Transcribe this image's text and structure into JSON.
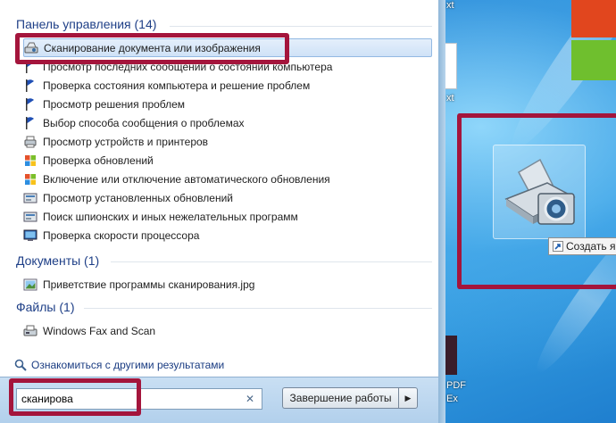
{
  "colors": {
    "annotation_red": "#a4153c",
    "group_header_blue": "#1e3f87",
    "selection_blue": "#cfe2f7",
    "desktop_blue": "#2b93dc"
  },
  "start_menu": {
    "groups": [
      {
        "header": "Панель управления (14)",
        "items": [
          {
            "label": "Сканирование документа или изображения",
            "icon": "scanner-icon",
            "selected": true
          },
          {
            "label": "Просмотр последних сообщений о состоянии компьютера",
            "icon": "flag-icon"
          },
          {
            "label": "Проверка состояния компьютера и решение проблем",
            "icon": "flag-icon"
          },
          {
            "label": "Просмотр решения проблем",
            "icon": "flag-icon"
          },
          {
            "label": "Выбор способа сообщения о проблемах",
            "icon": "flag-icon"
          },
          {
            "label": "Просмотр устройств и принтеров",
            "icon": "devices-icon"
          },
          {
            "label": "Проверка обновлений",
            "icon": "windows-update-icon"
          },
          {
            "label": "Включение или отключение автоматического обновления",
            "icon": "windows-update-icon"
          },
          {
            "label": "Просмотр установленных обновлений",
            "icon": "programs-icon"
          },
          {
            "label": "Поиск шпионских и иных нежелательных программ",
            "icon": "programs-icon"
          },
          {
            "label": "Проверка скорости процессора",
            "icon": "system-icon"
          }
        ]
      },
      {
        "header": "Документы (1)",
        "items": [
          {
            "label": "Приветствие программы сканирования.jpg",
            "icon": "image-file-icon"
          }
        ]
      },
      {
        "header": "Файлы (1)",
        "items": [
          {
            "label": "Windows Fax and Scan",
            "icon": "fax-icon"
          }
        ]
      }
    ],
    "see_more": "Ознакомиться с другими результатами",
    "search": {
      "value": "сканирова",
      "clear_icon": "clear-icon"
    },
    "shutdown_label": "Завершение работы",
    "shutdown_arrow_icon": "arrow-right-icon"
  },
  "desktop": {
    "drag_icon": "scanner-camera-icon",
    "create_tooltip": "Создать ярлык",
    "edge_texts": [
      "xt",
      "xt",
      "PDF",
      "Ex"
    ]
  }
}
